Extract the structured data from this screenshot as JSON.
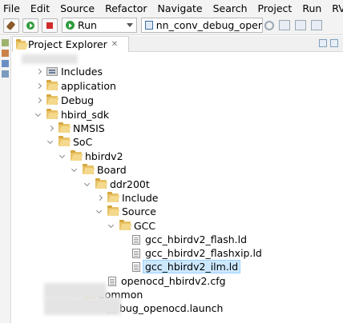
{
  "menu": [
    "File",
    "Edit",
    "Source",
    "Refactor",
    "Navigate",
    "Search",
    "Project",
    "Run",
    "RV-T"
  ],
  "toolbar": {
    "run_mode": "Run",
    "launch_config": "nn_conv_debug_oper"
  },
  "view": {
    "tab_label": "Project Explorer",
    "tab_close": "✕"
  },
  "tree": [
    {
      "label": "Includes",
      "icon": "includes-icon",
      "state": "collapsed"
    },
    {
      "label": "application",
      "icon": "folder-icon",
      "state": "collapsed"
    },
    {
      "label": "Debug",
      "icon": "folder-icon",
      "state": "collapsed"
    },
    {
      "label": "hbird_sdk",
      "icon": "folder-icon",
      "state": "expanded"
    },
    {
      "label": "NMSIS",
      "icon": "folder-icon",
      "state": "collapsed"
    },
    {
      "label": "SoC",
      "icon": "folder-icon",
      "state": "expanded"
    },
    {
      "label": "hbirdv2",
      "icon": "folder-icon",
      "state": "expanded"
    },
    {
      "label": "Board",
      "icon": "folder-icon",
      "state": "expanded"
    },
    {
      "label": "ddr200t",
      "icon": "folder-icon",
      "state": "expanded"
    },
    {
      "label": "Include",
      "icon": "folder-icon",
      "state": "collapsed"
    },
    {
      "label": "Source",
      "icon": "folder-icon",
      "state": "expanded"
    },
    {
      "label": "GCC",
      "icon": "folder-icon",
      "state": "expanded"
    },
    {
      "label": "gcc_hbirdv2_flash.ld",
      "icon": "file-icon",
      "state": "leaf"
    },
    {
      "label": "gcc_hbirdv2_flashxip.ld",
      "icon": "file-icon",
      "state": "leaf"
    },
    {
      "label": "gcc_hbirdv2_ilm.ld",
      "icon": "file-icon",
      "state": "leaf",
      "selected": true
    },
    {
      "label": "openocd_hbirdv2.cfg",
      "icon": "file-icon",
      "state": "leaf"
    },
    {
      "label": "Common",
      "icon": "folder-icon",
      "state": "collapsed"
    },
    {
      "label": "bug_openocd.launch",
      "icon": "launch-file-icon",
      "state": "leaf"
    }
  ],
  "colors": {
    "selection_bg": "#cce8ff",
    "folder": "#e9c267",
    "chrome_bg": "#f3f3f3"
  }
}
